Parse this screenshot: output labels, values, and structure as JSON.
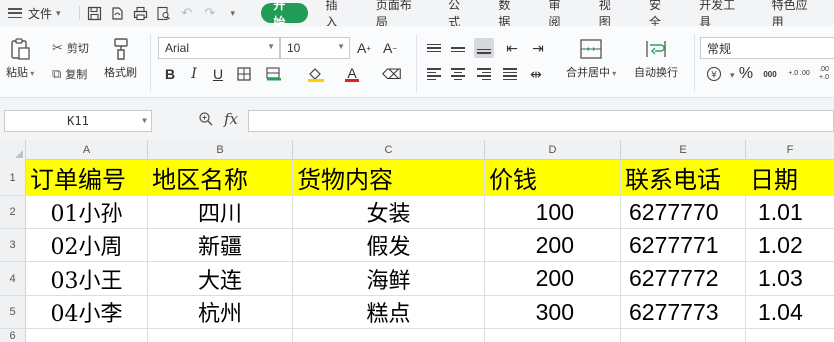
{
  "menu": {
    "file_label": "文件",
    "tabs": [
      "开始",
      "插入",
      "页面布局",
      "公式",
      "数据",
      "审阅",
      "视图",
      "安全",
      "开发工具",
      "特色应用"
    ],
    "active_tab": "开始"
  },
  "ribbon": {
    "paste_label": "粘贴",
    "cut_label": "剪切",
    "copy_label": "复制",
    "format_painter_label": "格式刷",
    "font_name": "Arial",
    "font_size": "10",
    "merge_center_label": "合并居中",
    "wrap_text_label": "自动换行",
    "number_format": "常规",
    "percent_symbol": "%",
    "decimal_labels": [
      "000",
      "+.0 .00",
      ".00 +.0"
    ]
  },
  "formula_bar": {
    "cell_ref": "K11",
    "fx_label": "fx",
    "formula": ""
  },
  "sheet": {
    "columns": [
      "A",
      "B",
      "C",
      "D",
      "E",
      "F"
    ],
    "rows": [
      "1",
      "2",
      "3",
      "4",
      "5",
      "6"
    ],
    "header": [
      "订单编号",
      "地区名称",
      "货物内容",
      "价钱",
      "联系电话",
      "日期"
    ],
    "data": [
      [
        "01小孙",
        "四川",
        "女装",
        "100",
        "6277770",
        "1.01"
      ],
      [
        "02小周",
        "新疆",
        "假发",
        "200",
        "6277771",
        "1.02"
      ],
      [
        "03小王",
        "大连",
        "海鲜",
        "200",
        "6277772",
        "1.03"
      ],
      [
        "04小李",
        "杭州",
        "糕点",
        "300",
        "6277773",
        "1.04"
      ]
    ],
    "header_fill": "#ffff00"
  }
}
